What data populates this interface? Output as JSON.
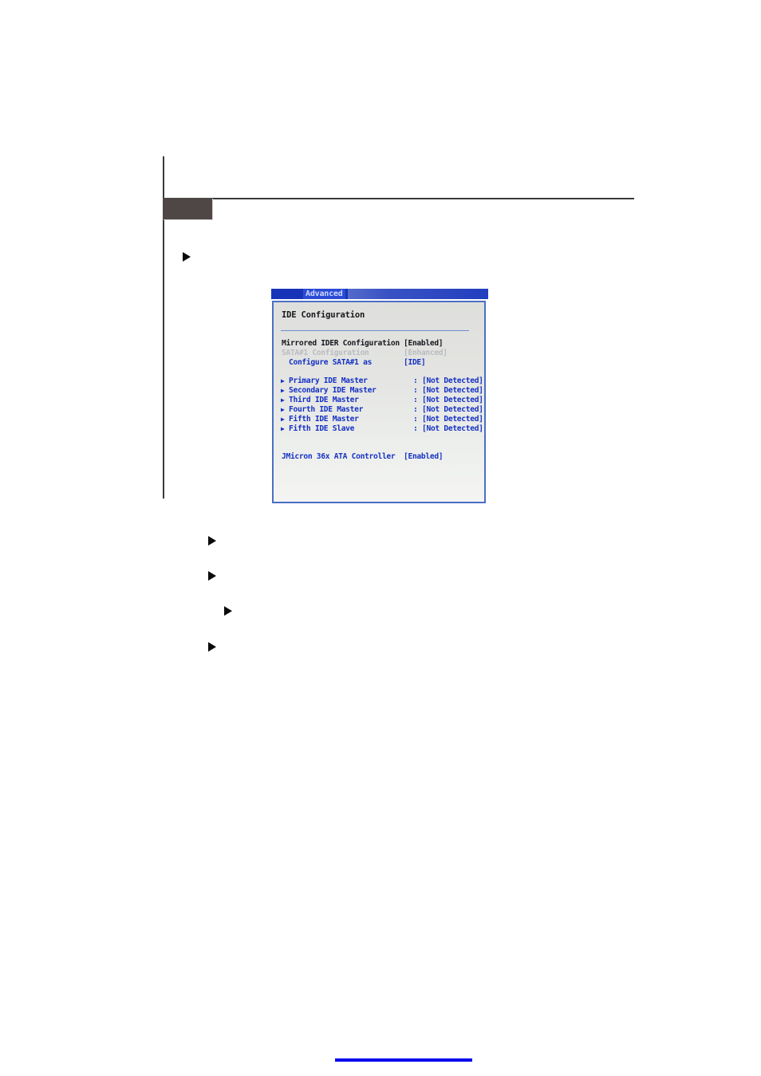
{
  "page": {
    "section_chip_label": "",
    "bullets": [
      {
        "name": "bullet-primary",
        "text": ""
      },
      {
        "name": "bullet-secondary-1",
        "text": ""
      },
      {
        "name": "bullet-secondary-2",
        "text": ""
      },
      {
        "name": "bullet-tertiary",
        "text": ""
      },
      {
        "name": "bullet-secondary-3",
        "text": ""
      }
    ]
  },
  "bios": {
    "tab": {
      "label": "Advanced"
    },
    "panel_title": "IDE Configuration",
    "settings": [
      {
        "label": "Mirrored IDER Configuration",
        "value": "[Enabled]",
        "state": "normal",
        "indent": 0,
        "caret": ""
      },
      {
        "label": "SATA#1 Configuration",
        "value": "[Enhanced]",
        "state": "disabled",
        "indent": 0,
        "caret": ""
      },
      {
        "label": "Configure SATA#1 as",
        "value": "[IDE]",
        "state": "normal",
        "indent": 1,
        "caret": ""
      }
    ],
    "devices": [
      {
        "caret": "▶",
        "label": "Primary IDE Master",
        "separator": ":",
        "value": "[Not Detected]"
      },
      {
        "caret": "▶",
        "label": "Secondary IDE Master",
        "separator": ":",
        "value": "[Not Detected]"
      },
      {
        "caret": "▶",
        "label": "Third IDE Master",
        "separator": ":",
        "value": "[Not Detected]"
      },
      {
        "caret": "▶",
        "label": "Fourth IDE Master",
        "separator": ":",
        "value": "[Not Detected]"
      },
      {
        "caret": "▶",
        "label": "Fifth IDE Master",
        "separator": ":",
        "value": "[Not Detected]"
      },
      {
        "caret": "▶",
        "label": "Fifth IDE Slave",
        "separator": ":",
        "value": "[Not Detected]"
      }
    ],
    "controller": {
      "label": "JMicron 36x ATA Controller",
      "value": "[Enabled]"
    }
  },
  "colors": {
    "bios_accent_blue": "#1530c4",
    "bios_tabbar_blue": "#1734b8",
    "bios_border_blue": "#4a6fc4",
    "bios_disabled_gray": "#b9bcc0",
    "page_rule_dark": "#3a3a3a",
    "chip_dark": "#4e4745",
    "footer_line_blue": "#0000ee"
  }
}
